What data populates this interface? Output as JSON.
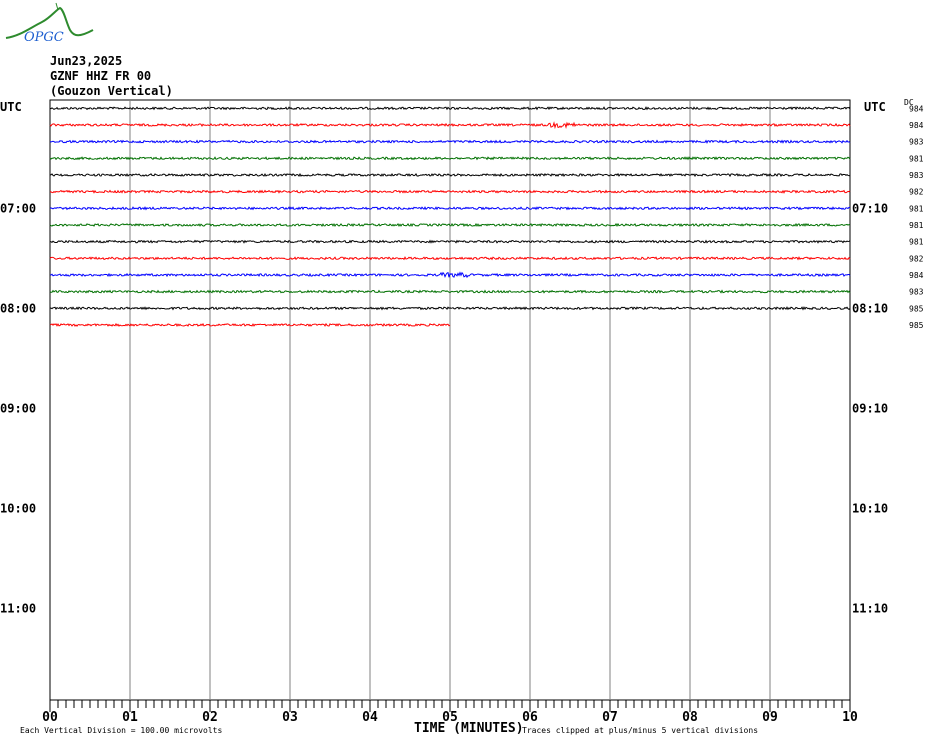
{
  "logo": {
    "text": "OPGC",
    "curve_color": "#2e8b2e",
    "text_color": "#1e5fd0"
  },
  "header": {
    "date": "Jun23,2025",
    "station": "GZNF HHZ FR 00",
    "location": "(Gouzon Vertical)"
  },
  "chart_data": {
    "type": "line",
    "title": "GZNF HHZ FR 00 helicorder",
    "left_axis_title": "UTC",
    "right_axis_title": "UTC",
    "dc_title": "DC",
    "left_hour_labels": [
      "07:00",
      "08:00",
      "09:00",
      "10:00",
      "11:00"
    ],
    "right_hour_labels": [
      "07:10",
      "08:10",
      "09:10",
      "10:10",
      "11:10"
    ],
    "x_tick_labels": [
      "00",
      "01",
      "02",
      "03",
      "04",
      "05",
      "06",
      "07",
      "08",
      "09",
      "10"
    ],
    "xlabel": "TIME (MINUTES)",
    "xlim": [
      0,
      10
    ],
    "rows_per_hour": 6,
    "total_rows": 36,
    "colors": [
      "#000000",
      "#ff0000",
      "#0000ff",
      "#007000"
    ],
    "traces": [
      {
        "dc": "984",
        "completeness": 1
      },
      {
        "dc": "984",
        "completeness": 1,
        "burst_minute": 6.4
      },
      {
        "dc": "983",
        "completeness": 1
      },
      {
        "dc": "981",
        "completeness": 1
      },
      {
        "dc": "983",
        "completeness": 1
      },
      {
        "dc": "982",
        "completeness": 1
      },
      {
        "dc": "981",
        "completeness": 1
      },
      {
        "dc": "981",
        "completeness": 1
      },
      {
        "dc": "981",
        "completeness": 1
      },
      {
        "dc": "982",
        "completeness": 1
      },
      {
        "dc": "984",
        "completeness": 1,
        "burst_minute": 5.05
      },
      {
        "dc": "983",
        "completeness": 1
      },
      {
        "dc": "985",
        "completeness": 1
      },
      {
        "dc": "985",
        "completeness": 0.5
      }
    ]
  },
  "footer": {
    "scale_note": "Each Vertical Division =  100.00 microvolts",
    "clip_note": "Traces clipped at plus/minus 5 vertical divisions"
  }
}
